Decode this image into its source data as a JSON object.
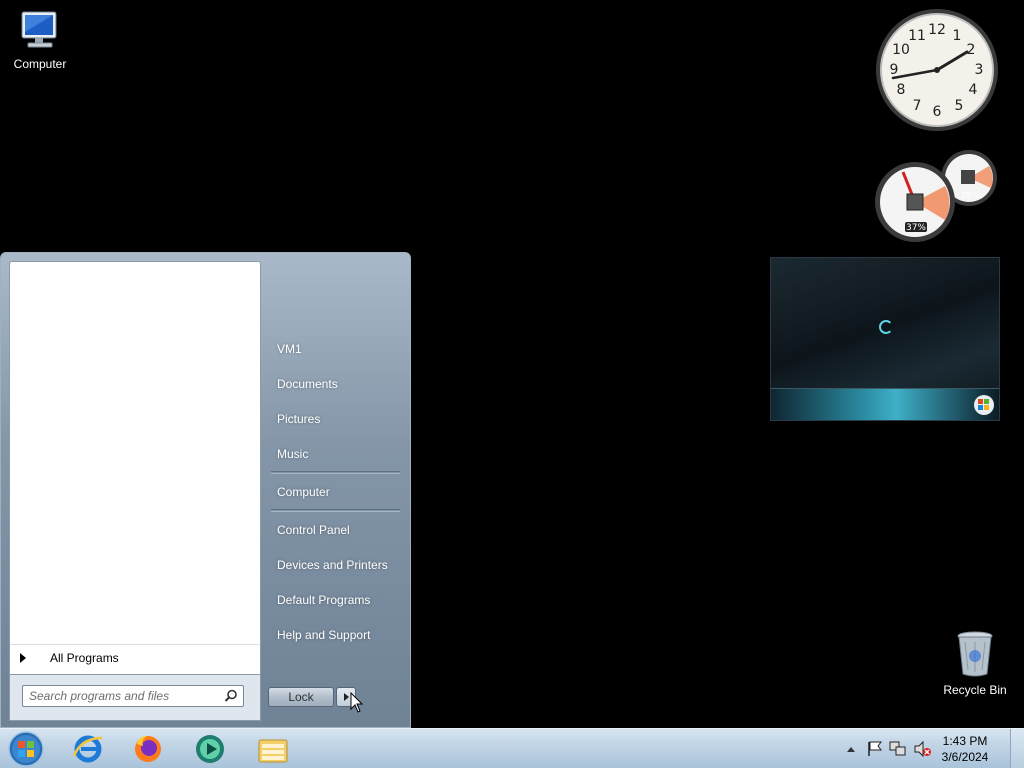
{
  "desktop": {
    "computer_label": "Computer",
    "recycle_label": "Recycle Bin"
  },
  "gadgets": {
    "clock_numbers": [
      "12",
      "1",
      "2",
      "3",
      "4",
      "5",
      "6",
      "7",
      "8",
      "9",
      "10",
      "11"
    ],
    "cpu_percent": "37%",
    "memory_percent": "39%"
  },
  "start_menu": {
    "all_programs": "All Programs",
    "search_placeholder": "Search programs and files",
    "right_items": [
      "VM1",
      "Documents",
      "Pictures",
      "Music",
      "Computer",
      "Control Panel",
      "Devices and Printers",
      "Default Programs",
      "Help and Support"
    ],
    "lock_label": "Lock"
  },
  "taskbar": {
    "pinned": [
      "internet-explorer-icon",
      "firefox-icon",
      "media-app-icon",
      "windows-explorer-icon"
    ],
    "time": "1:43 PM",
    "date": "3/6/2024"
  }
}
